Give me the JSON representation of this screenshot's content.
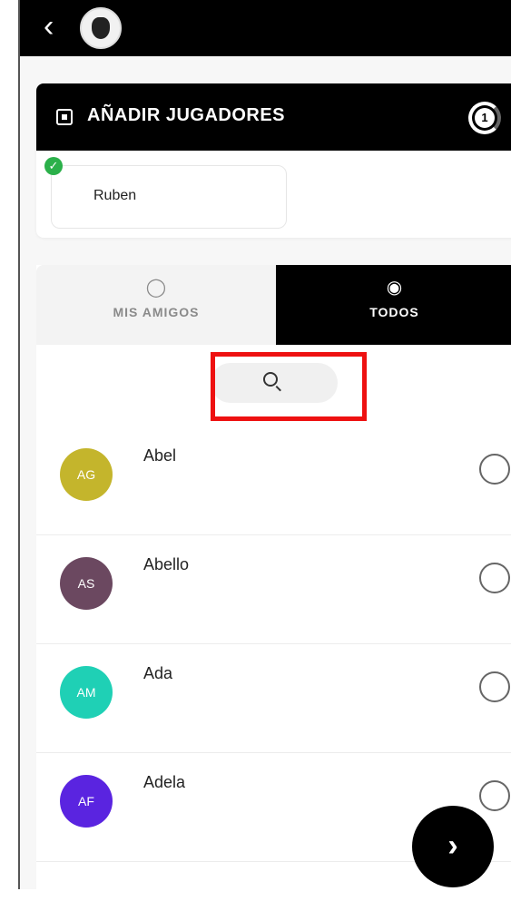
{
  "header": {
    "back_icon": "chevron-left-icon",
    "logo_icon": "club-crest-logo"
  },
  "players": {
    "title": "AÑADIR JUGADORES",
    "count": "1",
    "selected": [
      {
        "name": "Ruben",
        "status_icon": "check-circle-icon",
        "status_color": "#2bb04a"
      }
    ]
  },
  "tabs": [
    {
      "label": "MIS AMIGOS",
      "icon": "user-icon",
      "active": false
    },
    {
      "label": "TODOS",
      "icon": "group-icon",
      "active": true
    }
  ],
  "search": {
    "icon": "search-icon"
  },
  "list": [
    {
      "initials": "AG",
      "name": "Abel",
      "color": "#c4b52c"
    },
    {
      "initials": "AS",
      "name": "Abello",
      "color": "#6b4860"
    },
    {
      "initials": "AM",
      "name": "Ada",
      "color": "#1fd0b5"
    },
    {
      "initials": "AF",
      "name": "Adela",
      "color": "#5a24e0"
    }
  ],
  "fab": {
    "icon": "chevron-right-icon"
  },
  "colors": {
    "accent": "#000000",
    "highlight": "#e11111"
  }
}
